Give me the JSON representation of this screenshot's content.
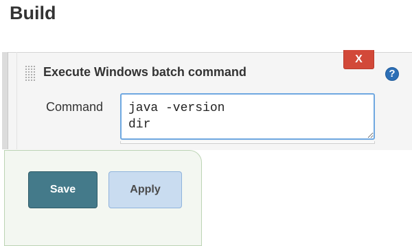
{
  "section": {
    "title": "Build"
  },
  "step": {
    "title": "Execute Windows batch command",
    "delete_label": "X",
    "help_label": "?",
    "command_label": "Command",
    "command_value": "java -version\ndir"
  },
  "actions": {
    "save_label": "Save",
    "apply_label": "Apply"
  },
  "colors": {
    "delete": "#d24939",
    "save": "#447a8a",
    "apply": "#c9dcf0",
    "help": "#2d6fb6",
    "input_border": "#6ea7e0",
    "bottom_bar": "#f3f7f1"
  },
  "icons": {
    "drag": "drag-handle-icon",
    "help": "help-icon"
  }
}
